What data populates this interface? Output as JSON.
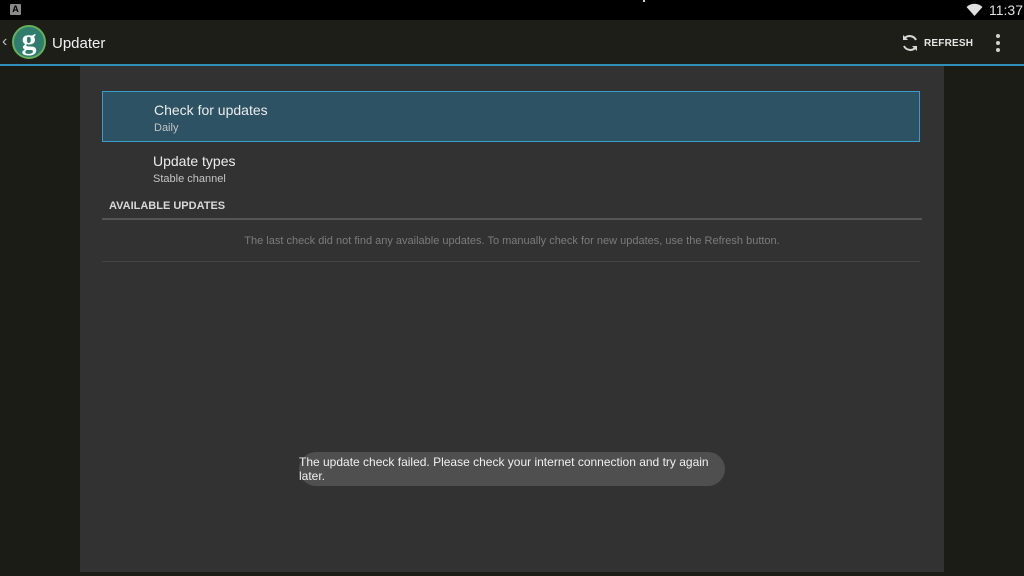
{
  "status_bar": {
    "notification_icon": "A",
    "time": "11:37",
    "wifi_icon": "wifi-icon"
  },
  "action_bar": {
    "title": "Updater",
    "up_glyph": "‹",
    "app_icon_letter": "g",
    "refresh_label": "REFRESH",
    "accent_color": "#2f8fb6"
  },
  "preferences": {
    "check_for_updates": {
      "title": "Check for updates",
      "summary": "Daily"
    },
    "update_types": {
      "title": "Update types",
      "summary": "Stable channel"
    }
  },
  "available_updates": {
    "header": "AVAILABLE UPDATES",
    "empty_message": "The last check did not find any available updates. To manually check for new updates, use the Refresh button."
  },
  "toast": {
    "message": "The update check failed. Please check your internet connection and try again later."
  }
}
